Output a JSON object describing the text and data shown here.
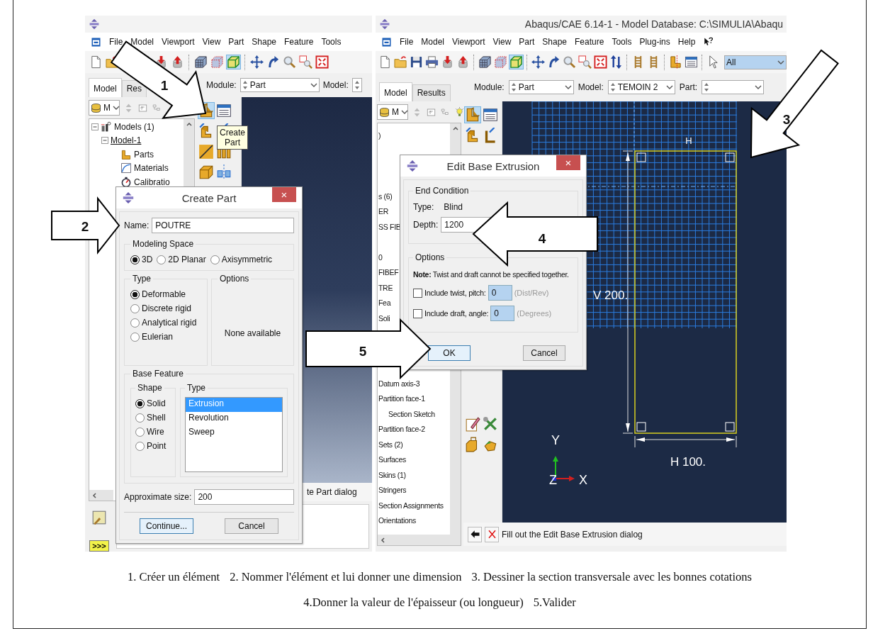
{
  "left_window": {
    "menu": [
      "File",
      "Model",
      "Viewport",
      "View",
      "Part",
      "Shape",
      "Feature",
      "Tools"
    ],
    "tabs": [
      {
        "label": "Model",
        "selected": true
      },
      {
        "label": "Res",
        "selected": false
      }
    ],
    "module": {
      "label": "Module:",
      "value": "Part"
    },
    "model": {
      "label": "Model:"
    },
    "tree_filter": "M",
    "tree": [
      {
        "label": "Models (1)",
        "expanded": true,
        "children": [
          {
            "label": "Model-1",
            "expanded": true,
            "current": true,
            "children": [
              {
                "label": "Parts"
              },
              {
                "label": "Materials"
              },
              {
                "label": "Calibratio"
              }
            ]
          }
        ]
      }
    ],
    "tooltip": "Create Part",
    "prompt": "te Part dialog",
    "command_toggle": ">>>"
  },
  "create_part_dialog": {
    "title": "Create Part",
    "close": "×",
    "name_label": "Name:",
    "name_value": "POUTRE",
    "modeling_space": {
      "title": "Modeling Space",
      "options": [
        {
          "label": "3D",
          "selected": true
        },
        {
          "label": "2D Planar",
          "selected": false
        },
        {
          "label": "Axisymmetric",
          "selected": false
        }
      ]
    },
    "type": {
      "title": "Type",
      "options": [
        {
          "label": "Deformable",
          "selected": true
        },
        {
          "label": "Discrete rigid",
          "selected": false
        },
        {
          "label": "Analytical rigid",
          "selected": false
        },
        {
          "label": "Eulerian",
          "selected": false
        }
      ]
    },
    "options": {
      "title": "Options",
      "text": "None available"
    },
    "base_feature": {
      "title": "Base Feature",
      "shape": {
        "title": "Shape",
        "options": [
          {
            "label": "Solid",
            "selected": true
          },
          {
            "label": "Shell",
            "selected": false
          },
          {
            "label": "Wire",
            "selected": false
          },
          {
            "label": "Point",
            "selected": false
          }
        ]
      },
      "type": {
        "title": "Type",
        "items": [
          {
            "label": "Extrusion",
            "selected": true
          },
          {
            "label": "Revolution",
            "selected": false
          },
          {
            "label": "Sweep",
            "selected": false
          }
        ]
      }
    },
    "size_label": "Approximate size:",
    "size_value": "200",
    "buttons": [
      {
        "label": "Continue...",
        "default": true
      },
      {
        "label": "Cancel",
        "default": false
      }
    ]
  },
  "right_window": {
    "title": "Abaqus/CAE 6.14-1 - Model Database: C:\\SIMULIA\\Abaqu",
    "menu": [
      "File",
      "Model",
      "Viewport",
      "View",
      "Part",
      "Shape",
      "Feature",
      "Tools",
      "Plug-ins",
      "Help"
    ],
    "selection_filter": "All",
    "tabs": [
      {
        "label": "Model",
        "selected": true
      },
      {
        "label": "Results",
        "selected": false
      }
    ],
    "module": {
      "label": "Module:",
      "value": "Part"
    },
    "model": {
      "label": "Model:",
      "value": "TEMOIN 2"
    },
    "part": {
      "label": "Part:"
    },
    "tree_filter": "M",
    "tree": [
      {
        "label": ")"
      },
      {
        "label": "s (6)"
      },
      {
        "label": "ER"
      },
      {
        "label": "SS FIB"
      },
      {
        "label": "0"
      },
      {
        "label": "FIBEF"
      },
      {
        "label": "TRE"
      },
      {
        "label": "Fea"
      },
      {
        "label": "Soli"
      },
      {
        "label": "Datum axis-3"
      },
      {
        "label": "Partition face-1",
        "children": [
          {
            "label": "Section Sketch"
          }
        ]
      },
      {
        "label": "Partition face-2"
      },
      {
        "label": "Sets (2)"
      },
      {
        "label": "Surfaces"
      },
      {
        "label": "Skins (1)"
      },
      {
        "label": "Stringers"
      },
      {
        "label": "Section Assignments"
      },
      {
        "label": "Orientations"
      }
    ],
    "sketch": {
      "width_label": "H",
      "height_dimension": "V 200.",
      "width_dimension": "H 100.",
      "axes": [
        "Y",
        "X",
        "Z"
      ]
    },
    "prompt": "Fill out the Edit Base Extrusion dialog"
  },
  "edit_base_extrusion_dialog": {
    "title": "Edit Base Extrusion",
    "close": "×",
    "end_condition": {
      "title": "End Condition",
      "type_label": "Type:",
      "type_value": "Blind",
      "depth_label": "Depth:",
      "depth_value": "1200"
    },
    "options": {
      "title": "Options",
      "note": "**Note:**  Twist and draft cannot be specified together.",
      "rows": [
        {
          "label": "Include twist, pitch:",
          "checked": false,
          "value": "0",
          "unit": "(Dist/Rev)"
        },
        {
          "label": "Include draft, angle:",
          "checked": false,
          "value": "0",
          "unit": "(Degrees)"
        }
      ]
    },
    "buttons": [
      {
        "label": "OK",
        "default": true
      },
      {
        "label": "Cancel",
        "default": false
      }
    ]
  },
  "callouts": [
    {
      "number": "1",
      "kind": "down-right"
    },
    {
      "number": "2",
      "kind": "right"
    },
    {
      "number": "3",
      "kind": "down-left"
    },
    {
      "number": "4",
      "kind": "left"
    },
    {
      "number": "5",
      "kind": "right"
    }
  ],
  "caption": [
    [
      "1. Créer un élément",
      "2. Nommer l'élément et lui donner une dimension",
      "3. Dessiner la section transversale avec les bonnes cotations"
    ],
    [
      "4.Donner la valeur de l'épaisseur (ou longueur)",
      "5.Valider"
    ]
  ]
}
